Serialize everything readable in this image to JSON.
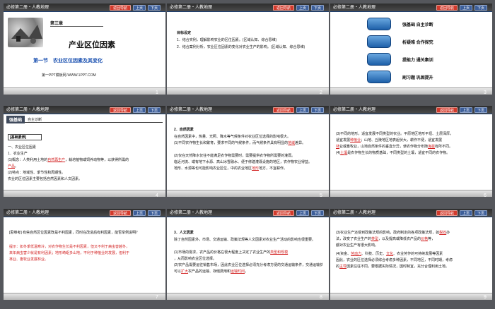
{
  "header": {
    "title": "必修第二册・人教地理",
    "back": "返回导航",
    "prev": "上页",
    "next": "下页"
  },
  "slides": {
    "s1": {
      "num": "1",
      "chapter": "第三章",
      "title": "产业区位因素",
      "section": "第一节　农业区位因素及其变化",
      "url": "第一PPT模板网-WWW.1PPT.COM"
    },
    "s2": {
      "num": "2",
      "goal_title": "目标设定",
      "goal1": "1．结合实例，理解影响农业的区位因素。(区域认知、综合思维)",
      "goal2": "2．结合案例分析，农业区位因素的变化对农业生产的影响。(区域认知、综合思维)"
    },
    "s3": {
      "num": "3",
      "items": [
        "强基础 自主诊断",
        "析疑难 合作探究",
        "提能力 通关集训",
        "刷习题 巩固提升"
      ]
    },
    "s4": {
      "num": "4",
      "banner": "强基础",
      "sub": "自主诊断",
      "tag": "[基础素养]",
      "l1": "一、农业区位因素",
      "l2": "1．农业生产",
      "l3a": "(1)概念：人类利用土地的",
      "l3b": "自然再生产",
      "l3c": "，栽培植物或饲养动物等，以获得所需的",
      "l4a": "产品",
      "l4b": "。",
      "l5": "(2)特点：地域性、季节性和周期性。",
      "l6": "农业的区位因素主要包括自然因素和人文因素。"
    },
    "s5": {
      "num": "5",
      "h": "2．自然因素",
      "p1": "在自然因素中，热量、光照、降水等气候条件对农业区位选择的影响很大。",
      "p2a": "(1)不同农作物生长和繁育，要求不同的气候条件，而气候条件具有明显的",
      "p2b": "地域",
      "p2c": "差异。",
      "p3": "(2)仅在天然降水仅往不能满足农作物需要时，需要提供农作物所需要的灌溉。",
      "p4": "临近河流、或有地下水源、高山冰雪融水、便于修建灌溉设施的地区，农作物农业得益。",
      "p5a": "地形、水源等也可能影响农业区位，中的农业地区",
      "p5b": "地形",
      "p5c": "地方，不宜耕作。"
    },
    "s6": {
      "num": "6",
      "p1": "(3)不同的地形，适宜发展不同类型的农业。平原地区地形平坦、土层深厚，",
      "p2a": "适宜发展",
      "p2b": "种植业",
      "p2c": "；山地、丘陵地区地表起伏大，耕作不便，适宜发展",
      "p3a": "林",
      "p3b": "业或畜牧业，山地自然条件的垂直分异，使农作物分布随",
      "p3c": "海拔",
      "p3d": "有所不同。",
      "p4a": "(4)",
      "p4b": "土壤",
      "p4c": "是农作物生长的物质基础，不同类型的土壤，适宜不同的农作物。"
    },
    "s7": {
      "num": "7",
      "q": "[思维考] 有些自然区位因素既是不利因素，同时在改造后有利因素，能否举例说明？",
      "a1": "提示：如冬季低温寒冷，对农作物生长是不利因素，但又不利于病虫害越冬，",
      "a2": "来年病虫害少就是有利因素；地形崎岖多山地，不利于种植业的发展，但利于",
      "a3": "林业、畜牧业发展林业。"
    },
    "s8": {
      "num": "8",
      "h": "3．人文因素",
      "p1": "除了自然因素外，市场、交通运输、政策法规等人文因素对农业生产活动的影响也很重要。",
      "p2a": "(1)市场的需求，农产品的价格在很大程度上决定了农业生产的",
      "p2b": "类型和规模",
      "p2c": "，从而影响农业区位选择。",
      "p3": "(2)农产品需要运往销售市场，因此农业区位选择必须充分考虑方便的交通运输条件，交通运输快捷，",
      "p4a": "可以",
      "p4b": "扩大",
      "p4c": "农产品的运输、存储费用和",
      "p4d": "运输时间",
      "p4e": "。"
    },
    "s9": {
      "num": "9",
      "p1": "(3)农业生产还受到政策法规的影响，政府制定的各项政策法规，如",
      "p1b": "税收",
      "p1c": "办",
      "p2": "法，改变了农业生产的",
      "p2b": "类型",
      "p2c": "，以及提高或降低农产品的",
      "p2d": "价格",
      "p2e": "等，",
      "p3": "都对农业生产有很大影响。",
      "p4a": "(4)资金、",
      "p4b": "劳动力",
      "p4c": "、科技、历史、",
      "p4d": "文化",
      "p4e": "、农业劳作的可持续发展等因素",
      "p5": "因此，农业的区位选择必须综合考虑多种因素，不同地区，不同时期，考虑",
      "p6a": "的",
      "p6b": "主导",
      "p6c": "因素往往不同，要根据实际情况，因时制宜，充分合理利用土地。"
    }
  }
}
